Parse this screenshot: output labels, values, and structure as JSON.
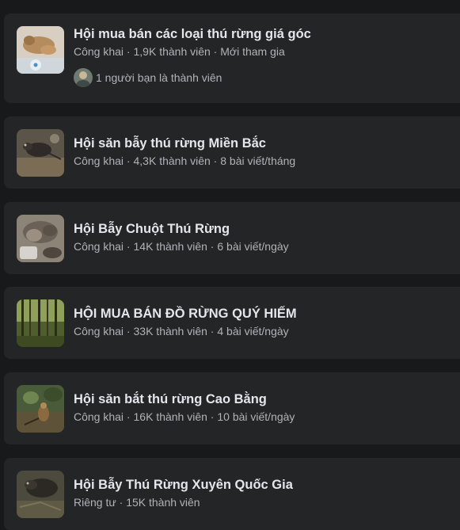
{
  "groups": [
    {
      "name": "Hội mua bán các loại thú rừng giá góc",
      "privacy": "Công khai",
      "members": "1,9K thành viên",
      "activity": "Mới tham gia",
      "friends_text": "1 người bạn là thành viên"
    },
    {
      "name": "Hội săn bẫy thú rừng Miền Bắc",
      "privacy": "Công khai",
      "members": "4,3K thành viên",
      "activity": "8 bài viết/tháng"
    },
    {
      "name": "Hội Bẫy Chuột Thú Rừng",
      "privacy": "Công khai",
      "members": "14K thành viên",
      "activity": "6 bài viết/ngày"
    },
    {
      "name": "HỘI MUA BÁN ĐỒ RỪNG QUÝ HIẾM",
      "privacy": "Công khai",
      "members": "33K thành viên",
      "activity": "4 bài viết/ngày"
    },
    {
      "name": "Hội săn bắt thú rừng Cao Bằng",
      "privacy": "Công khai",
      "members": "16K thành viên",
      "activity": "10 bài viết/ngày"
    },
    {
      "name": "Hội Bẫy Thú Rừng Xuyên Quốc Gia",
      "privacy": "Riêng tư",
      "members": "15K thành viên"
    }
  ],
  "separator": " · ",
  "colors": {
    "page_background": "#18191a",
    "card_background": "#242526",
    "title_text": "#e4e6eb",
    "secondary_text": "#b0b3b8"
  }
}
